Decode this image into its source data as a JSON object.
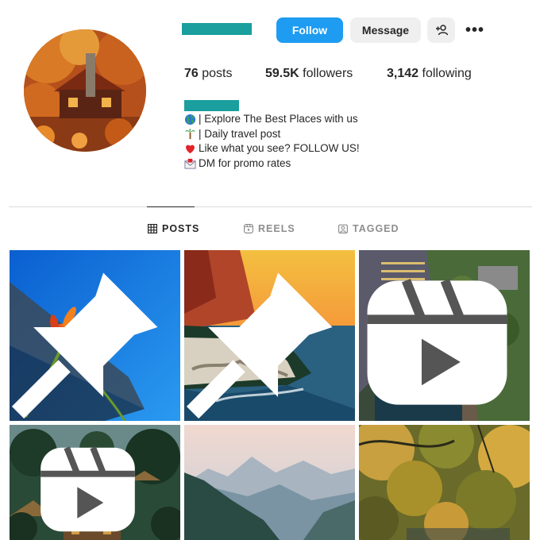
{
  "profile": {
    "posts_count": "76",
    "posts_label": " posts",
    "followers_count": "59.5K",
    "followers_label": " followers",
    "following_count": "3,142",
    "following_label": " following"
  },
  "actions": {
    "follow_label": "Follow",
    "message_label": "Message",
    "add_user_icon": "person-plus-icon",
    "more_icon": "more-options-icon",
    "more_glyph": "•••"
  },
  "bio": {
    "lines": [
      {
        "icon": "globe-icon",
        "text": "| Explore The Best Places with us"
      },
      {
        "icon": "palm-tree-icon",
        "text": "| Daily travel post"
      },
      {
        "icon": "red-heart-icon",
        "text": "Like what you see? FOLLOW US!"
      },
      {
        "icon": "envelope-icon",
        "text": "DM for promo rates"
      }
    ]
  },
  "tabs": [
    {
      "label": "POSTS",
      "icon": "grid-icon",
      "active": true
    },
    {
      "label": "REELS",
      "icon": "reels-icon",
      "active": false
    },
    {
      "label": "TAGGED",
      "icon": "tagged-icon",
      "active": false
    }
  ],
  "grid": {
    "tiles": [
      {
        "subject": "butterfly on orange flower",
        "badge": "pin-icon"
      },
      {
        "subject": "sunset sea cliffs",
        "badge": "pin-icon"
      },
      {
        "subject": "quarry hotel aerial",
        "badge": "reel-icon"
      },
      {
        "subject": "jungle bamboo hut",
        "badge": "reel-icon"
      },
      {
        "subject": "misty mountains",
        "badge": ""
      },
      {
        "subject": "autumn forest",
        "badge": ""
      }
    ]
  },
  "colors": {
    "accent": "#1e9cf1",
    "redaction": "#1a9e9e",
    "secondary_button": "#efefef",
    "divider": "#dbdbdb"
  }
}
